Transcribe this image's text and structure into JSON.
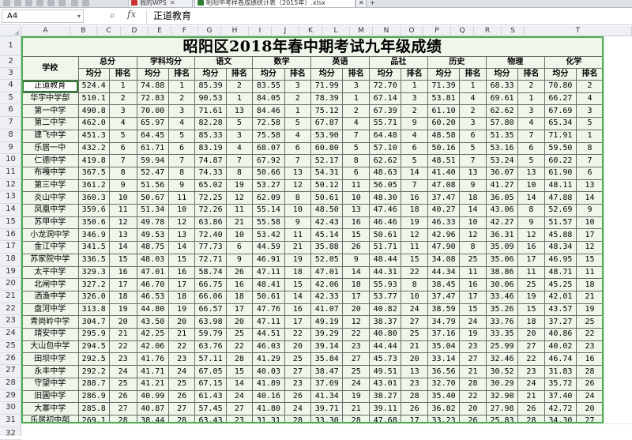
{
  "tabs": [
    {
      "label": "我的WPS",
      "icon_color": "#cc3333",
      "closable": true
    },
    {
      "label": "昭阳中考样卷成绩统计表（2015年）.xlsx",
      "icon_color": "#2e7d32",
      "closable": true
    }
  ],
  "formula_bar": {
    "cell_ref": "A4",
    "value": "正道教育",
    "fx_label": "fx"
  },
  "columns": [
    "A",
    "B",
    "C",
    "D",
    "E",
    "F",
    "G",
    "H",
    "I",
    "J",
    "K",
    "L",
    "M",
    "N",
    "O",
    "P",
    "Q",
    "R",
    "S",
    "T"
  ],
  "rows": [
    "1",
    "2",
    "3",
    "4",
    "5",
    "6",
    "7",
    "8",
    "9",
    "10",
    "11",
    "12",
    "13",
    "14",
    "15",
    "16",
    "17",
    "18",
    "19",
    "20",
    "21",
    "22",
    "23",
    "24",
    "25",
    "26",
    "27",
    "28",
    "29",
    "30",
    "31",
    "32"
  ],
  "sheet": {
    "title": "昭阳区2018年春中期考试九年级成绩",
    "school_header": "学校",
    "groups": [
      "总分",
      "学科均分",
      "语文",
      "数学",
      "英语",
      "品社",
      "历史",
      "物理",
      "化学"
    ],
    "sub": [
      "均分",
      "排名",
      "均分",
      "排名",
      "均分",
      "排名",
      "均分",
      "排名",
      "均分",
      "排名",
      "均分",
      "排名",
      "均分",
      "排名",
      "均分",
      "排名",
      "均分",
      "排名"
    ],
    "data": [
      [
        "正道教育",
        "524.4",
        "1",
        "74.88",
        "1",
        "85.39",
        "2",
        "83.55",
        "3",
        "71.99",
        "3",
        "72.70",
        "1",
        "71.39",
        "1",
        "68.33",
        "2",
        "70.80",
        "2"
      ],
      [
        "华宇中学部",
        "510.1",
        "2",
        "72.83",
        "2",
        "90.53",
        "1",
        "84.05",
        "2",
        "78.39",
        "1",
        "67.14",
        "3",
        "53.81",
        "4",
        "69.61",
        "1",
        "66.27",
        "4"
      ],
      [
        "第一中学",
        "490.8",
        "3",
        "70.00",
        "3",
        "71.61",
        "13",
        "84.46",
        "1",
        "75.12",
        "2",
        "67.39",
        "2",
        "61.10",
        "2",
        "62.62",
        "3",
        "67.69",
        "3"
      ],
      [
        "第二中学",
        "462.0",
        "4",
        "65.97",
        "4",
        "82.28",
        "5",
        "72.58",
        "5",
        "67.87",
        "4",
        "55.71",
        "9",
        "60.20",
        "3",
        "57.80",
        "4",
        "65.34",
        "5"
      ],
      [
        "建飞中学",
        "451.3",
        "5",
        "64.45",
        "5",
        "85.33",
        "3",
        "75.58",
        "4",
        "53.90",
        "7",
        "64.48",
        "4",
        "48.58",
        "6",
        "51.35",
        "7",
        "71.91",
        "1"
      ],
      [
        "乐居一中",
        "432.2",
        "6",
        "61.71",
        "6",
        "83.19",
        "4",
        "68.07",
        "6",
        "60.80",
        "5",
        "57.10",
        "6",
        "50.16",
        "5",
        "53.16",
        "6",
        "59.50",
        "8"
      ],
      [
        "仁德中学",
        "419.8",
        "7",
        "59.94",
        "7",
        "74.87",
        "7",
        "67.92",
        "7",
        "52.17",
        "8",
        "62.62",
        "5",
        "48.51",
        "7",
        "53.24",
        "5",
        "60.22",
        "7"
      ],
      [
        "布嘎中学",
        "367.5",
        "8",
        "52.47",
        "8",
        "74.33",
        "8",
        "50.66",
        "13",
        "54.31",
        "6",
        "48.63",
        "14",
        "41.40",
        "13",
        "36.07",
        "13",
        "61.90",
        "6"
      ],
      [
        "第三中学",
        "361.2",
        "9",
        "51.56",
        "9",
        "65.02",
        "19",
        "53.27",
        "12",
        "50.12",
        "11",
        "56.05",
        "7",
        "47.08",
        "9",
        "41.27",
        "10",
        "48.11",
        "13"
      ],
      [
        "炎山中学",
        "360.3",
        "10",
        "50.67",
        "11",
        "72.25",
        "12",
        "62.09",
        "8",
        "50.61",
        "10",
        "48.30",
        "16",
        "37.47",
        "18",
        "36.05",
        "14",
        "47.88",
        "14"
      ],
      [
        "凤凰中学",
        "359.6",
        "11",
        "51.34",
        "10",
        "72.26",
        "11",
        "55.14",
        "10",
        "48.50",
        "13",
        "47.46",
        "18",
        "40.27",
        "14",
        "43.06",
        "8",
        "52.69",
        "9"
      ],
      [
        "苏甲中学",
        "350.6",
        "12",
        "49.78",
        "12",
        "63.86",
        "21",
        "55.58",
        "9",
        "42.43",
        "16",
        "46.46",
        "19",
        "46.33",
        "10",
        "42.27",
        "9",
        "51.57",
        "10"
      ],
      [
        "小龙洞中学",
        "346.9",
        "13",
        "49.53",
        "13",
        "72.40",
        "10",
        "53.42",
        "11",
        "45.14",
        "15",
        "50.61",
        "12",
        "42.96",
        "12",
        "36.31",
        "12",
        "45.88",
        "17"
      ],
      [
        "金江中学",
        "341.5",
        "14",
        "48.75",
        "14",
        "77.73",
        "6",
        "44.59",
        "21",
        "35.88",
        "26",
        "51.71",
        "11",
        "47.90",
        "8",
        "35.09",
        "16",
        "48.34",
        "12"
      ],
      [
        "苏家院中学",
        "336.5",
        "15",
        "48.03",
        "15",
        "72.71",
        "9",
        "46.91",
        "19",
        "52.05",
        "9",
        "48.44",
        "15",
        "34.08",
        "25",
        "35.06",
        "17",
        "46.95",
        "15"
      ],
      [
        "太平中学",
        "329.3",
        "16",
        "47.01",
        "16",
        "58.74",
        "26",
        "47.11",
        "18",
        "47.01",
        "14",
        "44.31",
        "22",
        "44.34",
        "11",
        "38.86",
        "11",
        "48.71",
        "11"
      ],
      [
        "北闸中学",
        "327.2",
        "17",
        "46.70",
        "17",
        "66.75",
        "16",
        "48.41",
        "15",
        "42.06",
        "18",
        "55.93",
        "8",
        "38.45",
        "16",
        "30.06",
        "25",
        "45.25",
        "18"
      ],
      [
        "洒渔中学",
        "326.0",
        "18",
        "46.53",
        "18",
        "66.06",
        "18",
        "50.61",
        "14",
        "42.33",
        "17",
        "53.77",
        "10",
        "37.47",
        "17",
        "33.46",
        "19",
        "42.01",
        "21"
      ],
      [
        "盘河中学",
        "313.8",
        "19",
        "44.80",
        "19",
        "66.57",
        "17",
        "47.76",
        "16",
        "41.07",
        "20",
        "40.82",
        "24",
        "38.59",
        "15",
        "35.26",
        "15",
        "43.57",
        "19"
      ],
      [
        "青岗岭中学",
        "304.7",
        "20",
        "43.50",
        "20",
        "63.98",
        "20",
        "47.11",
        "17",
        "49.19",
        "12",
        "38.37",
        "27",
        "34.79",
        "24",
        "33.76",
        "18",
        "37.27",
        "25"
      ],
      [
        "靖安中学",
        "295.9",
        "21",
        "42.25",
        "21",
        "59.79",
        "25",
        "44.51",
        "22",
        "39.29",
        "22",
        "40.80",
        "25",
        "37.16",
        "19",
        "33.35",
        "20",
        "40.86",
        "22"
      ],
      [
        "大山包中学",
        "294.5",
        "22",
        "42.06",
        "22",
        "63.76",
        "22",
        "46.03",
        "20",
        "39.14",
        "23",
        "44.44",
        "21",
        "35.04",
        "23",
        "25.99",
        "27",
        "40.02",
        "23"
      ],
      [
        "田坝中学",
        "292.5",
        "23",
        "41.76",
        "23",
        "57.11",
        "28",
        "41.29",
        "25",
        "35.84",
        "27",
        "45.73",
        "20",
        "33.14",
        "27",
        "32.46",
        "22",
        "46.74",
        "16"
      ],
      [
        "永丰中学",
        "292.2",
        "24",
        "41.71",
        "24",
        "67.05",
        "15",
        "40.03",
        "27",
        "38.47",
        "25",
        "49.51",
        "13",
        "36.56",
        "21",
        "30.52",
        "23",
        "31.83",
        "28"
      ],
      [
        "守望中学",
        "288.7",
        "25",
        "41.21",
        "25",
        "67.15",
        "14",
        "41.89",
        "23",
        "37.69",
        "24",
        "43.01",
        "23",
        "32.70",
        "28",
        "30.29",
        "24",
        "35.72",
        "26"
      ],
      [
        "旧圃中学",
        "286.9",
        "26",
        "40.99",
        "26",
        "61.43",
        "24",
        "40.16",
        "26",
        "41.34",
        "19",
        "38.27",
        "28",
        "35.40",
        "22",
        "32.90",
        "21",
        "37.40",
        "24"
      ],
      [
        "大寨中学",
        "285.8",
        "27",
        "40.87",
        "27",
        "57.45",
        "27",
        "41.80",
        "24",
        "39.71",
        "21",
        "39.11",
        "26",
        "36.82",
        "20",
        "27.98",
        "26",
        "42.72",
        "20"
      ],
      [
        "乐居初中部",
        "269.1",
        "28",
        "38.44",
        "28",
        "63.43",
        "23",
        "31.31",
        "28",
        "33.30",
        "28",
        "47.68",
        "17",
        "33.23",
        "26",
        "25.83",
        "28",
        "34.30",
        "27"
      ]
    ]
  },
  "colors": {
    "sheet_fill": "#f0f7ea",
    "outline": "#4caf50",
    "selection": "#2e7d32"
  }
}
